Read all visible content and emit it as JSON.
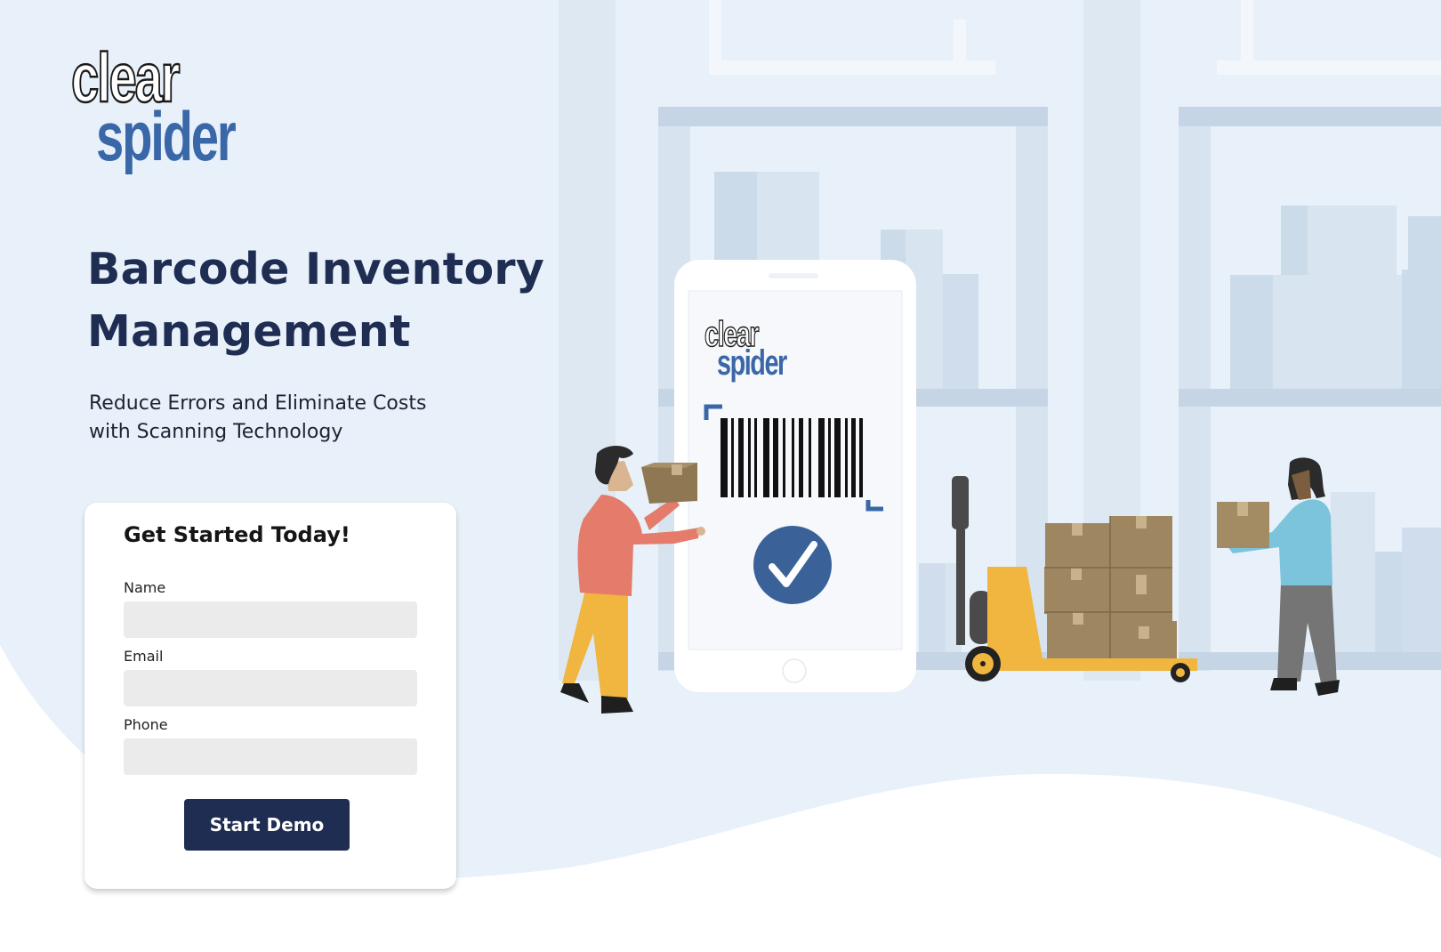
{
  "brand": {
    "logo_line1": "clear",
    "logo_line2": "spider",
    "color_dark": "#1f2d52",
    "color_blue": "#3a67a8"
  },
  "hero": {
    "title": "Barcode Inventory Management",
    "subtitle": "Reduce Errors and Eliminate Costs with Scanning Technology"
  },
  "form": {
    "heading": "Get Started Today!",
    "fields": [
      {
        "label": "Name",
        "value": "",
        "placeholder": ""
      },
      {
        "label": "Email",
        "value": "",
        "placeholder": ""
      },
      {
        "label": "Phone",
        "value": "",
        "placeholder": ""
      }
    ],
    "submit_label": "Start Demo"
  },
  "illustration": {
    "phone_logo_line1": "clear",
    "phone_logo_line2": "spider",
    "icons": [
      "barcode-icon",
      "checkmark-icon"
    ],
    "colors": {
      "background": "#e8f1fa",
      "shelf": "#c6d5e6",
      "box": "#9e8760",
      "pallet_jack": "#f0b63f",
      "check": "#3a6299"
    }
  }
}
